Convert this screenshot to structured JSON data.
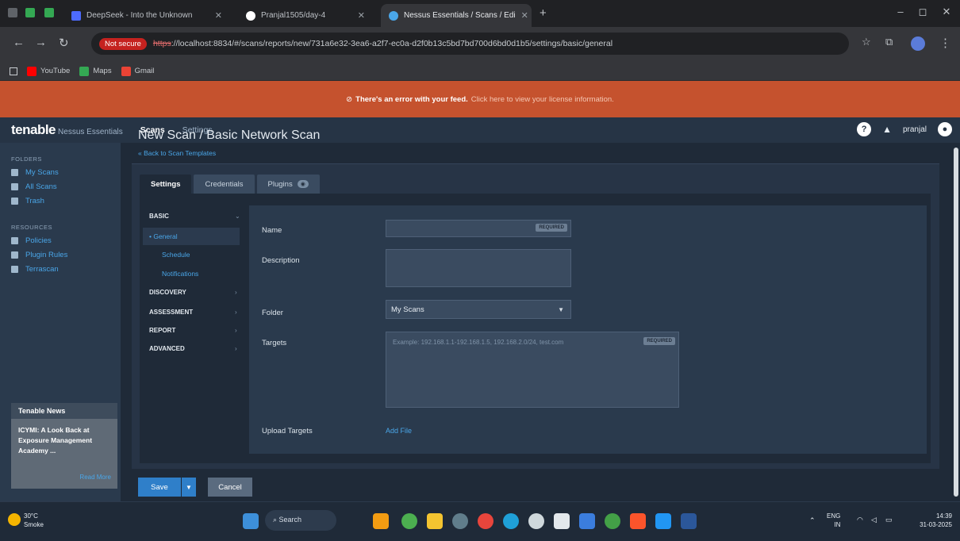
{
  "browser": {
    "tabs": [
      {
        "label": "DeepSeek - Into the Unknown"
      },
      {
        "label": "Pranjal1505/day-4"
      },
      {
        "label": "Nessus Essentials / Scans / Edi"
      }
    ],
    "new_tab": "+",
    "not_secure": "Not secure",
    "url_scheme": "https",
    "url_rest": "://localhost:8834/#/scans/reports/new/731a6e32-3ea6-a2f7-ec0a-d2f0b13c5bd7bd700d6bd0d1b5/settings/basic/general",
    "bookmarks": [
      {
        "label": "YouTube",
        "color": "#ff0000"
      },
      {
        "label": "Maps",
        "color": "#34a853"
      },
      {
        "label": "Gmail",
        "color": "#ea4335"
      }
    ]
  },
  "error_banner": {
    "text": "There's an error with your feed.",
    "link": "Click here to view your license information."
  },
  "app": {
    "logo": "tenable",
    "logo_sub": "Nessus Essentials",
    "nav": [
      "Scans",
      "Settings"
    ],
    "user": "pranjal"
  },
  "sidebar": {
    "folders_title": "FOLDERS",
    "folders": [
      "My Scans",
      "All Scans",
      "Trash"
    ],
    "resources_title": "RESOURCES",
    "resources": [
      "Policies",
      "Plugin Rules",
      "Terrascan"
    ],
    "news": {
      "title": "Tenable News",
      "headline": "ICYMI: A Look Back at Exposure Management Academy ...",
      "more": "Read More"
    }
  },
  "page": {
    "title": "New Scan / Basic Network Scan",
    "back": "« Back to Scan Templates",
    "tabs": [
      "Settings",
      "Credentials",
      "Plugins"
    ]
  },
  "left_nav": {
    "basic": "BASIC",
    "basic_items": [
      "General",
      "Schedule",
      "Notifications"
    ],
    "sections": [
      "DISCOVERY",
      "ASSESSMENT",
      "REPORT",
      "ADVANCED"
    ]
  },
  "form": {
    "name_label": "Name",
    "description_label": "Description",
    "folder_label": "Folder",
    "folder_value": "My Scans",
    "targets_label": "Targets",
    "targets_placeholder": "Example: 192.168.1.1-192.168.1.5, 192.168.2.0/24, test.com",
    "upload_label": "Upload Targets",
    "add_file": "Add File",
    "required": "REQUIRED"
  },
  "actions": {
    "save": "Save",
    "cancel": "Cancel"
  },
  "taskbar": {
    "weather_temp": "30°C",
    "weather_desc": "Smoke",
    "search": "Search",
    "lang": "ENG",
    "region": "IN",
    "time": "14:39",
    "date": "31-03-2025"
  }
}
